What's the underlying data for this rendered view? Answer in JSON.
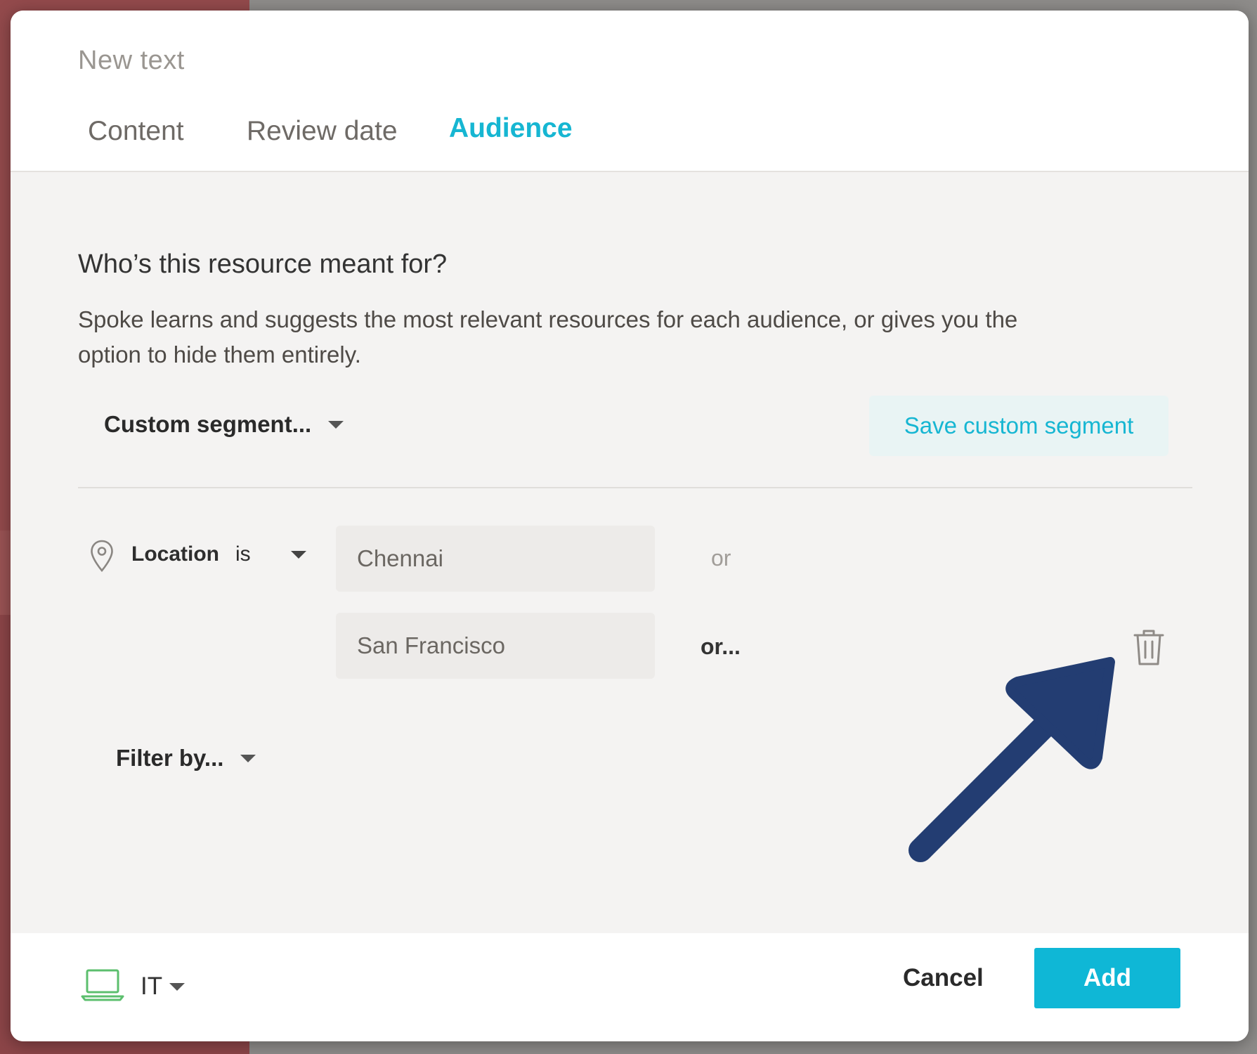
{
  "modal": {
    "title": "New text",
    "tabs": [
      {
        "label": "Content",
        "active": false
      },
      {
        "label": "Review date",
        "active": false
      },
      {
        "label": "Audience",
        "active": true
      }
    ]
  },
  "audience": {
    "question": "Who’s this resource meant for?",
    "description": "Spoke learns and suggests the most relevant resources for each audience, or gives you the option to hide them entirely.",
    "segment_select": "Custom segment...",
    "save_segment_label": "Save custom segment",
    "rule": {
      "attribute": "Location",
      "operator": "is",
      "values": [
        "Chennai",
        "San Francisco"
      ],
      "or_label": "or",
      "or_more_label": "or..."
    },
    "filter_label": "Filter by..."
  },
  "footer": {
    "department": "IT",
    "cancel_label": "Cancel",
    "add_label": "Add"
  },
  "icons": {
    "location": "location-pin-icon",
    "delete": "trash-icon",
    "department": "laptop-icon",
    "annotation": "arrow-annotation"
  },
  "colors": {
    "accent": "#16b6d2",
    "add_button": "#0fb7d6",
    "arrow": "#233d72",
    "laptop_icon": "#5cbf6e"
  }
}
